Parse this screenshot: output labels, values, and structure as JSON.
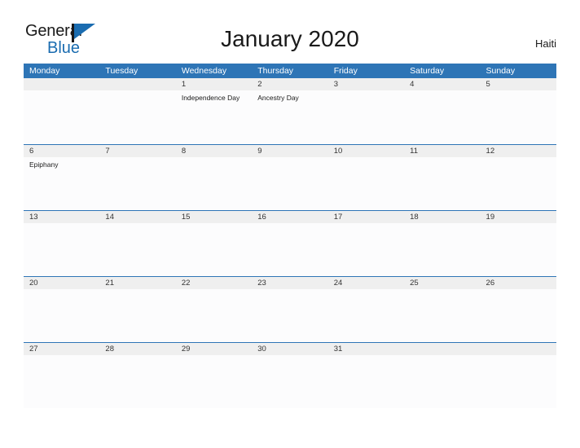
{
  "branding": {
    "logo_text_1": "General",
    "logo_text_2": "Blue",
    "logo_accent_color": "#1a6cb0"
  },
  "header": {
    "title": "January 2020",
    "country": "Haiti",
    "header_bg_color": "#2e75b6",
    "band_bg_color": "#efefef"
  },
  "calendar": {
    "month": "January",
    "year": "2020",
    "weekdays": [
      "Monday",
      "Tuesday",
      "Wednesday",
      "Thursday",
      "Friday",
      "Saturday",
      "Sunday"
    ],
    "weeks": [
      {
        "days": [
          {
            "num": "",
            "events": []
          },
          {
            "num": "",
            "events": []
          },
          {
            "num": "1",
            "events": [
              "Independence Day"
            ]
          },
          {
            "num": "2",
            "events": [
              "Ancestry Day"
            ]
          },
          {
            "num": "3",
            "events": []
          },
          {
            "num": "4",
            "events": []
          },
          {
            "num": "5",
            "events": []
          }
        ]
      },
      {
        "days": [
          {
            "num": "6",
            "events": [
              "Epiphany"
            ]
          },
          {
            "num": "7",
            "events": []
          },
          {
            "num": "8",
            "events": []
          },
          {
            "num": "9",
            "events": []
          },
          {
            "num": "10",
            "events": []
          },
          {
            "num": "11",
            "events": []
          },
          {
            "num": "12",
            "events": []
          }
        ]
      },
      {
        "days": [
          {
            "num": "13",
            "events": []
          },
          {
            "num": "14",
            "events": []
          },
          {
            "num": "15",
            "events": []
          },
          {
            "num": "16",
            "events": []
          },
          {
            "num": "17",
            "events": []
          },
          {
            "num": "18",
            "events": []
          },
          {
            "num": "19",
            "events": []
          }
        ]
      },
      {
        "days": [
          {
            "num": "20",
            "events": []
          },
          {
            "num": "21",
            "events": []
          },
          {
            "num": "22",
            "events": []
          },
          {
            "num": "23",
            "events": []
          },
          {
            "num": "24",
            "events": []
          },
          {
            "num": "25",
            "events": []
          },
          {
            "num": "26",
            "events": []
          }
        ]
      },
      {
        "days": [
          {
            "num": "27",
            "events": []
          },
          {
            "num": "28",
            "events": []
          },
          {
            "num": "29",
            "events": []
          },
          {
            "num": "30",
            "events": []
          },
          {
            "num": "31",
            "events": []
          },
          {
            "num": "",
            "events": []
          },
          {
            "num": "",
            "events": []
          }
        ]
      }
    ]
  }
}
